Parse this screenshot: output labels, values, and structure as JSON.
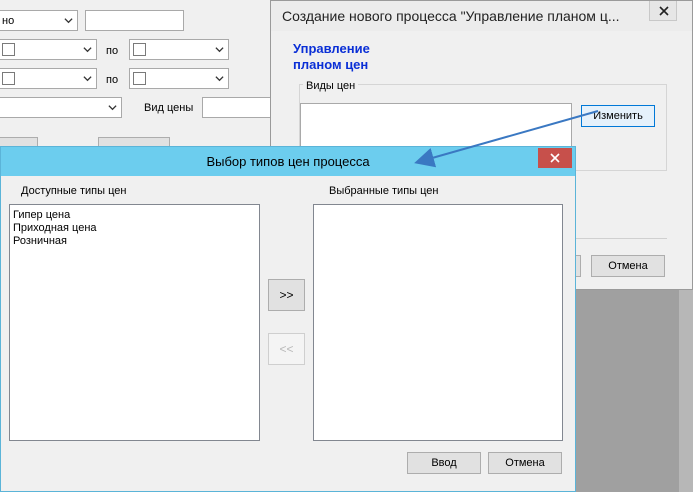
{
  "bgform": {
    "combo1_value": "но",
    "label_po": "по",
    "label_vid_ceny": "Вид цены"
  },
  "dialog_back": {
    "title": "Создание нового процесса \"Управление планом ц...",
    "heading": "Управление планом цен",
    "group_label": "Виды цен",
    "edit_button": "Изменить",
    "cancel_button": "Отмена"
  },
  "dialog_front": {
    "title": "Выбор типов цен процесса",
    "available_label": "Доступные типы цен",
    "selected_label": "Выбранные типы цен",
    "available_items": [
      "Гипер цена",
      "Приходная цена",
      "Розничная"
    ],
    "add_button": ">>",
    "remove_button": "<<",
    "ok_button": "Ввод",
    "cancel_button": "Отмена"
  },
  "colors": {
    "front_titlebar": "#6ccdee",
    "close_button": "#c7504b",
    "heading_blue": "#0a2fd6",
    "arrow": "#3a78c2"
  }
}
